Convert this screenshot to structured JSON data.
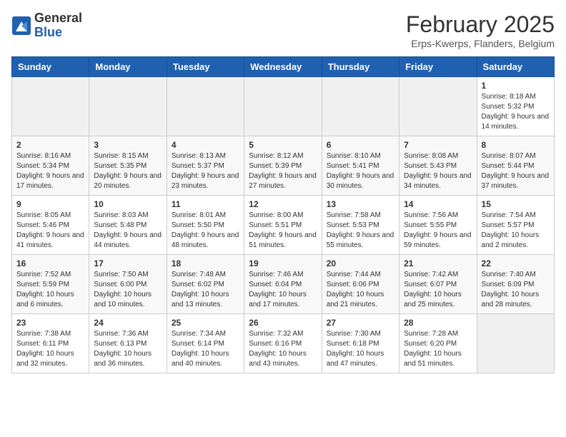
{
  "logo": {
    "general": "General",
    "blue": "Blue"
  },
  "title": "February 2025",
  "subtitle": "Erps-Kwerps, Flanders, Belgium",
  "days_of_week": [
    "Sunday",
    "Monday",
    "Tuesday",
    "Wednesday",
    "Thursday",
    "Friday",
    "Saturday"
  ],
  "weeks": [
    [
      {
        "day": "",
        "info": ""
      },
      {
        "day": "",
        "info": ""
      },
      {
        "day": "",
        "info": ""
      },
      {
        "day": "",
        "info": ""
      },
      {
        "day": "",
        "info": ""
      },
      {
        "day": "",
        "info": ""
      },
      {
        "day": "1",
        "info": "Sunrise: 8:18 AM\nSunset: 5:32 PM\nDaylight: 9 hours and 14 minutes."
      }
    ],
    [
      {
        "day": "2",
        "info": "Sunrise: 8:16 AM\nSunset: 5:34 PM\nDaylight: 9 hours and 17 minutes."
      },
      {
        "day": "3",
        "info": "Sunrise: 8:15 AM\nSunset: 5:35 PM\nDaylight: 9 hours and 20 minutes."
      },
      {
        "day": "4",
        "info": "Sunrise: 8:13 AM\nSunset: 5:37 PM\nDaylight: 9 hours and 23 minutes."
      },
      {
        "day": "5",
        "info": "Sunrise: 8:12 AM\nSunset: 5:39 PM\nDaylight: 9 hours and 27 minutes."
      },
      {
        "day": "6",
        "info": "Sunrise: 8:10 AM\nSunset: 5:41 PM\nDaylight: 9 hours and 30 minutes."
      },
      {
        "day": "7",
        "info": "Sunrise: 8:08 AM\nSunset: 5:43 PM\nDaylight: 9 hours and 34 minutes."
      },
      {
        "day": "8",
        "info": "Sunrise: 8:07 AM\nSunset: 5:44 PM\nDaylight: 9 hours and 37 minutes."
      }
    ],
    [
      {
        "day": "9",
        "info": "Sunrise: 8:05 AM\nSunset: 5:46 PM\nDaylight: 9 hours and 41 minutes."
      },
      {
        "day": "10",
        "info": "Sunrise: 8:03 AM\nSunset: 5:48 PM\nDaylight: 9 hours and 44 minutes."
      },
      {
        "day": "11",
        "info": "Sunrise: 8:01 AM\nSunset: 5:50 PM\nDaylight: 9 hours and 48 minutes."
      },
      {
        "day": "12",
        "info": "Sunrise: 8:00 AM\nSunset: 5:51 PM\nDaylight: 9 hours and 51 minutes."
      },
      {
        "day": "13",
        "info": "Sunrise: 7:58 AM\nSunset: 5:53 PM\nDaylight: 9 hours and 55 minutes."
      },
      {
        "day": "14",
        "info": "Sunrise: 7:56 AM\nSunset: 5:55 PM\nDaylight: 9 hours and 59 minutes."
      },
      {
        "day": "15",
        "info": "Sunrise: 7:54 AM\nSunset: 5:57 PM\nDaylight: 10 hours and 2 minutes."
      }
    ],
    [
      {
        "day": "16",
        "info": "Sunrise: 7:52 AM\nSunset: 5:59 PM\nDaylight: 10 hours and 6 minutes."
      },
      {
        "day": "17",
        "info": "Sunrise: 7:50 AM\nSunset: 6:00 PM\nDaylight: 10 hours and 10 minutes."
      },
      {
        "day": "18",
        "info": "Sunrise: 7:48 AM\nSunset: 6:02 PM\nDaylight: 10 hours and 13 minutes."
      },
      {
        "day": "19",
        "info": "Sunrise: 7:46 AM\nSunset: 6:04 PM\nDaylight: 10 hours and 17 minutes."
      },
      {
        "day": "20",
        "info": "Sunrise: 7:44 AM\nSunset: 6:06 PM\nDaylight: 10 hours and 21 minutes."
      },
      {
        "day": "21",
        "info": "Sunrise: 7:42 AM\nSunset: 6:07 PM\nDaylight: 10 hours and 25 minutes."
      },
      {
        "day": "22",
        "info": "Sunrise: 7:40 AM\nSunset: 6:09 PM\nDaylight: 10 hours and 28 minutes."
      }
    ],
    [
      {
        "day": "23",
        "info": "Sunrise: 7:38 AM\nSunset: 6:11 PM\nDaylight: 10 hours and 32 minutes."
      },
      {
        "day": "24",
        "info": "Sunrise: 7:36 AM\nSunset: 6:13 PM\nDaylight: 10 hours and 36 minutes."
      },
      {
        "day": "25",
        "info": "Sunrise: 7:34 AM\nSunset: 6:14 PM\nDaylight: 10 hours and 40 minutes."
      },
      {
        "day": "26",
        "info": "Sunrise: 7:32 AM\nSunset: 6:16 PM\nDaylight: 10 hours and 43 minutes."
      },
      {
        "day": "27",
        "info": "Sunrise: 7:30 AM\nSunset: 6:18 PM\nDaylight: 10 hours and 47 minutes."
      },
      {
        "day": "28",
        "info": "Sunrise: 7:28 AM\nSunset: 6:20 PM\nDaylight: 10 hours and 51 minutes."
      },
      {
        "day": "",
        "info": ""
      }
    ]
  ]
}
